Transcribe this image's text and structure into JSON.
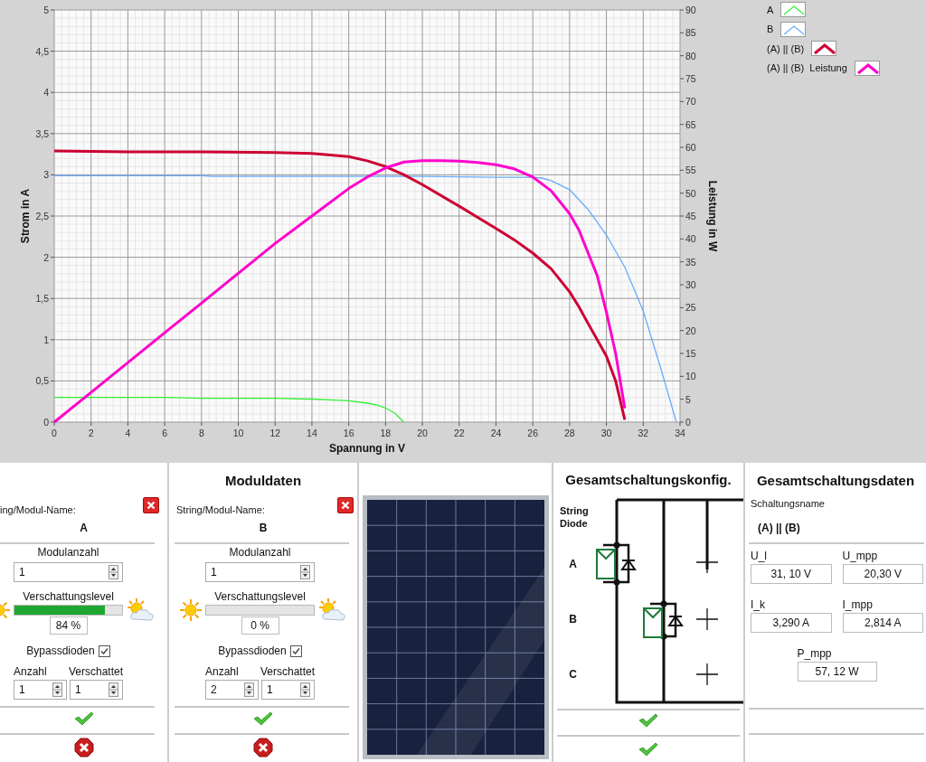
{
  "chart": {
    "chart_data": {
      "type": "line",
      "grid": true,
      "legend": "right",
      "xlabel": "Spannung in V",
      "ylabel": "Strom in A",
      "y2label": "Leistung in W",
      "xlim": [
        0,
        34
      ],
      "ylim": [
        0,
        5
      ],
      "y2lim": [
        0,
        90
      ],
      "xticks": [
        0,
        2,
        4,
        6,
        8,
        10,
        12,
        14,
        16,
        18,
        20,
        22,
        24,
        26,
        28,
        30,
        32,
        34
      ],
      "yticks": [
        0,
        {
          "value": 0.5,
          "label": "0,5"
        },
        1,
        {
          "value": 1.5,
          "label": "1,5"
        },
        2,
        {
          "value": 2.5,
          "label": "2,5"
        },
        3,
        {
          "value": 3.5,
          "label": "3,5"
        },
        4,
        {
          "value": 4.5,
          "label": "4,5"
        },
        5
      ],
      "y2ticks": [
        0,
        5,
        10,
        15,
        20,
        25,
        30,
        35,
        40,
        45,
        50,
        55,
        60,
        65,
        70,
        75,
        80,
        85,
        90
      ],
      "series": [
        {
          "name": "A",
          "color": "#33ee33",
          "x": [
            0,
            2,
            4,
            6,
            8,
            10,
            12,
            14,
            15,
            16,
            17,
            17.5,
            18,
            18.5,
            19
          ],
          "values": [
            0.3,
            0.3,
            0.3,
            0.3,
            0.29,
            0.29,
            0.29,
            0.28,
            0.27,
            0.26,
            0.23,
            0.21,
            0.17,
            0.11,
            0
          ]
        },
        {
          "name": "B",
          "color": "#66aaff",
          "x": [
            0,
            8,
            8.6,
            16,
            20,
            24,
            26,
            26.5,
            27,
            28,
            29,
            30,
            31,
            32,
            33,
            33.8
          ],
          "values": [
            2.99,
            2.99,
            2.98,
            2.98,
            2.98,
            2.97,
            2.97,
            2.96,
            2.93,
            2.82,
            2.58,
            2.27,
            1.88,
            1.35,
            0.62,
            0
          ]
        },
        {
          "name": "(A) || (B)",
          "color": "#cc0033",
          "x": [
            0,
            4,
            8,
            12,
            14,
            15,
            16,
            17,
            18,
            19,
            20,
            22,
            24,
            25,
            26,
            27,
            28,
            28.5,
            29,
            29.5,
            30,
            30.5,
            31
          ],
          "values": [
            3.29,
            3.28,
            3.28,
            3.27,
            3.26,
            3.24,
            3.22,
            3.17,
            3.1,
            3.0,
            2.88,
            2.62,
            2.35,
            2.21,
            2.05,
            1.86,
            1.58,
            1.4,
            1.2,
            1.0,
            0.8,
            0.5,
            0.03
          ]
        },
        {
          "name": "(A) || (B)  Leistung",
          "color": "#ff00cc",
          "axis": "y2",
          "x": [
            0,
            2,
            4,
            6,
            8,
            10,
            12,
            14,
            16,
            17,
            18,
            19,
            20,
            21,
            22,
            23,
            24,
            25,
            26,
            27,
            28,
            28.5,
            29,
            29.5,
            30,
            30.5,
            31
          ],
          "values": [
            0,
            6.5,
            13,
            19.5,
            26,
            32.5,
            39,
            45,
            51,
            53.5,
            55.5,
            56.8,
            57.1,
            57.1,
            57,
            56.7,
            56.2,
            55.3,
            53.5,
            50.5,
            45.5,
            42,
            37,
            32,
            24,
            15,
            3
          ]
        }
      ]
    }
  },
  "module_heading": "Moduldaten",
  "modules": [
    {
      "name_label": "ing/Modul-Name:",
      "name": "A",
      "count_label": "Modulanzahl",
      "count": "1",
      "shading_label": "Verschattungslevel",
      "level": 0.84,
      "shading_reading": "84 %",
      "bypass_label": "Bypassdioden",
      "bypass_checked": true,
      "diodes_label": "Anzahl",
      "diodes": "1",
      "shaded_label": "Verschattet",
      "shaded": "1"
    },
    {
      "name_label": "String/Modul-Name:",
      "name": "B",
      "count_label": "Modulanzahl",
      "count": "1",
      "shading_label": "Verschattungslevel",
      "level": 0,
      "shading_reading": "0 %",
      "bypass_label": "Bypassdioden",
      "bypass_checked": true,
      "diodes_label": "Anzahl",
      "diodes": "2",
      "shaded_label": "Verschattet",
      "shaded": "1"
    }
  ],
  "config": {
    "title": "Gesamtschaltungskonfig.",
    "header": "String Diode",
    "rows": [
      "A",
      "B",
      "C"
    ]
  },
  "results": {
    "title": "Gesamtschaltungsdaten",
    "name_label": "Schaltungsname",
    "name": "(A) || (B)",
    "fields": [
      {
        "label": "U_l",
        "value": "31, 10 V"
      },
      {
        "label": "U_mpp",
        "value": "20,30 V"
      },
      {
        "label": "I_k",
        "value": "3,290 A"
      },
      {
        "label": "I_mpp",
        "value": "2,814 A"
      },
      {
        "label": "P_mpp",
        "value": "57, 12 W"
      }
    ]
  }
}
